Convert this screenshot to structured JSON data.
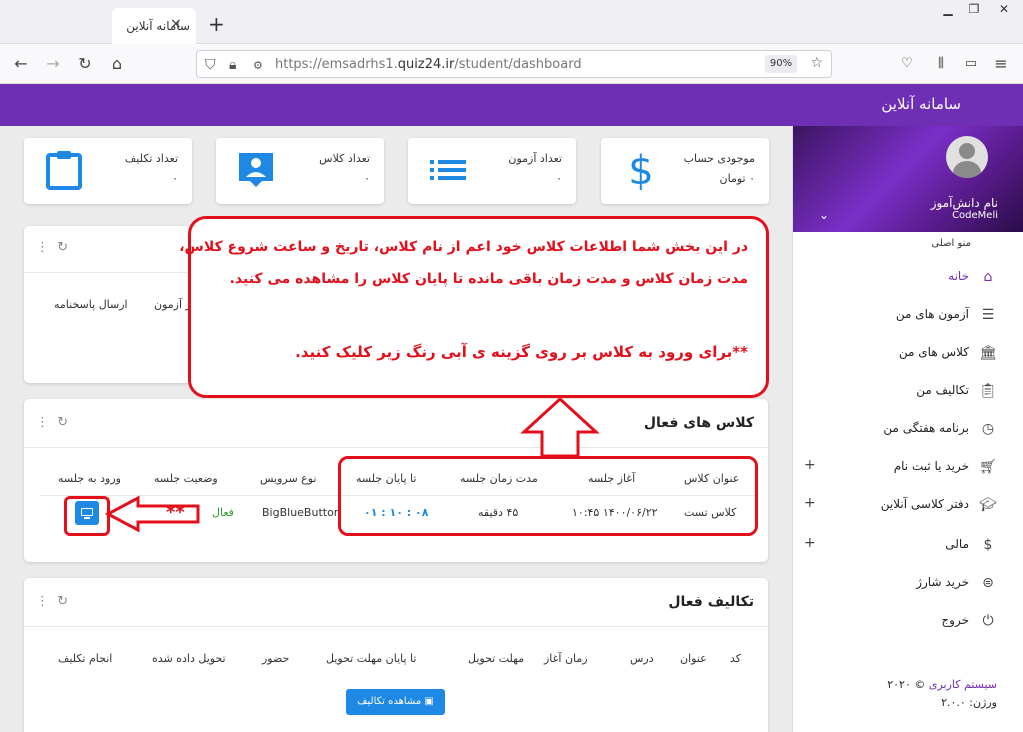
{
  "browser": {
    "tab_title": "سامانه آنلاین",
    "tab_close": "×",
    "new_tab": "+",
    "url_prefix": "https://emsadrhs1.",
    "url_domain": "quiz24.ir",
    "url_path": "/student/dashboard",
    "zoom": "90%"
  },
  "app": {
    "title": "سامانه آنلاین"
  },
  "profile": {
    "name": "نام دانش‌آموز",
    "code": "CodeMeli"
  },
  "sidebar": {
    "menu_heading": "منو اصلی",
    "items": [
      {
        "label": "خانه",
        "icon": "home-icon",
        "active": true,
        "expandable": false
      },
      {
        "label": "آزمون های من",
        "icon": "list-icon",
        "active": false,
        "expandable": false
      },
      {
        "label": "کلاس های من",
        "icon": "bank-icon",
        "active": false,
        "expandable": false
      },
      {
        "label": "تکالیف من",
        "icon": "clipboard-icon",
        "active": false,
        "expandable": false
      },
      {
        "label": "برنامه هفتگی من",
        "icon": "clock-icon",
        "active": false,
        "expandable": false
      },
      {
        "label": "خرید یا ثبت نام",
        "icon": "cart-icon",
        "active": false,
        "expandable": true
      },
      {
        "label": "دفتر کلاسی آنلاین",
        "icon": "graduation-cap-icon",
        "active": false,
        "expandable": true
      },
      {
        "label": "مالی",
        "icon": "dollar-icon",
        "active": false,
        "expandable": true
      },
      {
        "label": "خرید شارژ",
        "icon": "coin-icon",
        "active": false,
        "expandable": false
      },
      {
        "label": "خروج",
        "icon": "power-icon",
        "active": false,
        "expandable": false
      }
    ],
    "footer_brand": "سیستم کاربری",
    "footer_year": "© ۲۰۲۰",
    "footer_version": "ورژن: ۲.۰.۰"
  },
  "stats": [
    {
      "label": "موجودی حساب",
      "value": "۰ تومان",
      "icon": "dollar-icon",
      "color": "#1e88e5"
    },
    {
      "label": "تعداد آزمون",
      "value": "۰",
      "icon": "list-icon",
      "color": "#1e88e5"
    },
    {
      "label": "تعداد کلاس",
      "value": "۰",
      "icon": "person-badge-icon",
      "color": "#1e88e5"
    },
    {
      "label": "تعداد تکلیف",
      "value": "۰",
      "icon": "clipboard-icon",
      "color": "#1e88e5"
    }
  ],
  "exams_card": {
    "header_partial_1": "ارسال پاسخنامه",
    "header_partial_2": "ر آزمون"
  },
  "classes_card": {
    "title": "کلاس های فعال",
    "headers": [
      "عنوان کلاس",
      "آغاز جلسه",
      "مدت زمان جلسه",
      "تا پایان جلسه",
      "نوع سرویس",
      "وضعیت جلسه",
      "ورود به جلسه"
    ],
    "rows": [
      {
        "title": "کلاس تست",
        "start": "۱۴۰۰/۰۶/۲۲ ۱۰:۴۵",
        "duration": "۴۵ دقیقه",
        "remaining": "۰۸ : ۱۰ : ۰۱",
        "service": "BigBlueButton",
        "status": "فعال"
      }
    ]
  },
  "assignments_card": {
    "title": "تکالیف فعال",
    "headers": [
      "کد",
      "عنوان",
      "درس",
      "زمان آغاز",
      "مهلت تحویل",
      "تا پایان مهلت تحویل",
      "حضور",
      "تحویل داده شده",
      "انجام تکلیف"
    ],
    "view_button": "مشاهده تکالیف فعال"
  },
  "annotation": {
    "line1": "در این بخش شما اطلاعات کلاس خود اعم از نام کلاس، تاریخ و ساعت شروع کلاس،",
    "line2": "مدت زمان کلاس و مدت زمان باقی مانده تا پایان کلاس را مشاهده می کنید.",
    "line3": "**برای ورود به کلاس بر روی گزینه ی آبی رنگ زیر کلیک کنید.",
    "stars": "**",
    "color": "#e3101c"
  }
}
